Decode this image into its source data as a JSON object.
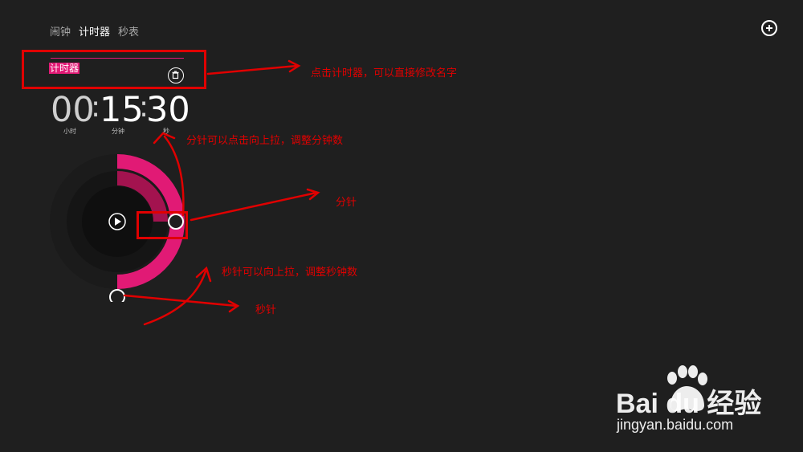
{
  "tabs": [
    {
      "label": "闹钟",
      "active": false
    },
    {
      "label": "计时器",
      "active": true
    },
    {
      "label": "秒表",
      "active": false
    }
  ],
  "timer": {
    "name": "计时器",
    "hours": "00",
    "minutes": "15",
    "seconds": "30",
    "separator": ":",
    "units": {
      "hours": "小时",
      "minutes": "分钟",
      "seconds": "秒"
    },
    "accent_color": "#e11a75",
    "minute_fill_fraction": 0.25,
    "second_fill_fraction": 0.5
  },
  "annotations": {
    "rename": "点击计时器，可以直接修改名字",
    "minute_drag": "分针可以点击向上拉，调整分钟数",
    "minute_hand": "分针",
    "second_drag": "秒针可以向上拉，调整秒钟数",
    "second_hand": "秒针",
    "color": "#e00000"
  },
  "watermark": {
    "brand": "Bai du 经验",
    "url": "jingyan.baidu.com"
  }
}
